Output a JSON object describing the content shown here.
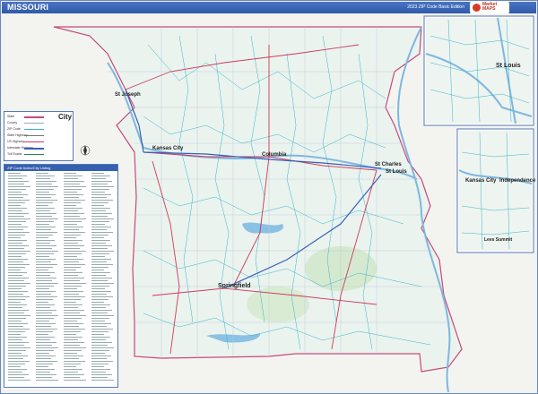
{
  "header": {
    "title": "MISSOURI",
    "edition": "2023 ZIP Code Basic Edition",
    "logo_text": "Market MAPS"
  },
  "legend": {
    "rows": [
      "State",
      "County",
      "ZIP Code",
      "State Highway",
      "US Highway",
      "Interstate Highway",
      "Toll Roads"
    ],
    "city_label": "City"
  },
  "index": {
    "header": "ZIP Code Index/City Listing"
  },
  "cities": {
    "st_joseph": "St Joseph",
    "kansas_city": "Kansas City",
    "columbia": "Columbia",
    "st_charles": "St Charles",
    "st_louis_main": "St Louis",
    "springfield": "Springfield",
    "st_louis_inset": "St Louis",
    "kansas_city_inset": "Kansas City",
    "independence_inset": "Independence",
    "lees_summit_inset": "Lees Summit"
  },
  "colors": {
    "frame": "#6b86c4",
    "title_bar": "#3560b0",
    "county_fill": "#e9f1ec",
    "zip_lines": "#39b6c8",
    "highways": "#d2385e",
    "interstate": "#3a5fb8",
    "water": "#7fb7df"
  }
}
